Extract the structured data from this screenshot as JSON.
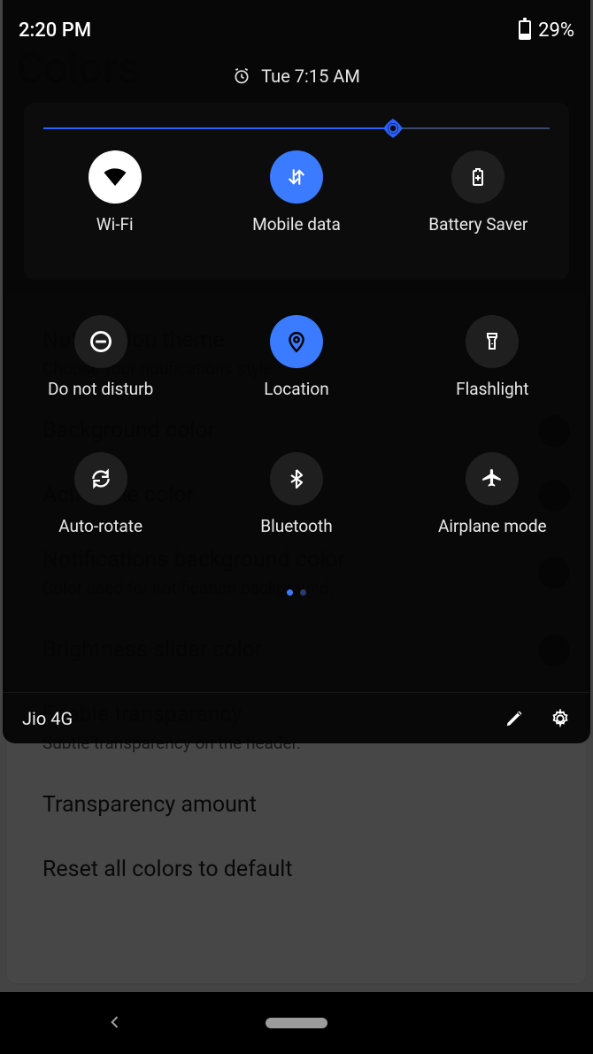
{
  "status": {
    "time": "2:20 PM",
    "battery": "29%"
  },
  "alarm": {
    "text": "Tue 7:15 AM"
  },
  "slider": {
    "value": 69
  },
  "tiles": {
    "row1": [
      {
        "id": "wifi",
        "label": "Wi-Fi"
      },
      {
        "id": "mobile-data",
        "label": "Mobile data"
      },
      {
        "id": "battery-saver",
        "label": "Battery Saver"
      }
    ],
    "row2": [
      {
        "id": "dnd",
        "label": "Do not disturb"
      },
      {
        "id": "location",
        "label": "Location"
      },
      {
        "id": "flashlight",
        "label": "Flashlight"
      }
    ],
    "row3": [
      {
        "id": "autorotate",
        "label": "Auto-rotate"
      },
      {
        "id": "bluetooth",
        "label": "Bluetooth"
      },
      {
        "id": "airplane",
        "label": "Airplane mode"
      }
    ]
  },
  "footer": {
    "carrier": "Jio 4G"
  },
  "background": {
    "title": "Colors",
    "items": [
      {
        "title": "Notification theme",
        "subtitle": "Choose your notifications style."
      },
      {
        "title": "Background color",
        "subtitle": ""
      },
      {
        "title": "Active tile color",
        "subtitle": ""
      },
      {
        "title": "Notifications background color",
        "subtitle": "Color used for notification background."
      },
      {
        "title": "Brightness slider color",
        "subtitle": ""
      },
      {
        "title": "Enable transparency",
        "subtitle": "Subtle transparency on the header."
      },
      {
        "title": "Transparency amount",
        "subtitle": ""
      },
      {
        "title": "Reset all colors to default",
        "subtitle": ""
      }
    ]
  }
}
